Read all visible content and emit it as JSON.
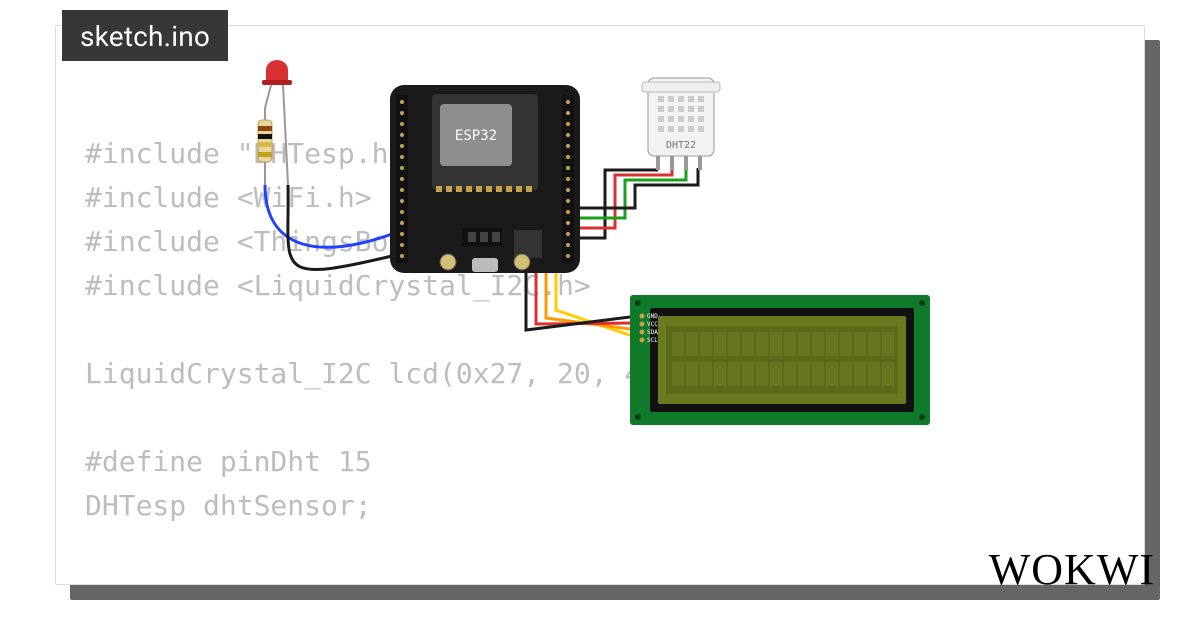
{
  "tab": {
    "filename": "sketch.ino"
  },
  "code": {
    "line1": "#include \"DHTesp.h\"",
    "line2": "#include <WiFi.h>",
    "line3": "#include <ThingsBoard.h>",
    "line4": "#include <LiquidCrystal_I2C.h>",
    "line5": "",
    "line6": "LiquidCrystal_I2C lcd(0x27, 20, 4);",
    "line7": "",
    "line8": "#define pinDht 15",
    "line9": "DHTesp dhtSensor;"
  },
  "components": {
    "mcu": {
      "label": "ESP32"
    },
    "sensor": {
      "label": "DHT22"
    },
    "lcd": {
      "pins": [
        "GND",
        "VCC",
        "SDA",
        "SCL"
      ]
    },
    "led": {
      "color": "#d83131"
    }
  },
  "colors": {
    "board": "#1a1a1a",
    "chip": "#8e8e8e",
    "lcd_pcb": "#0e7a2a",
    "lcd_screen": "#6b7a1e",
    "lcd_glass": "#4a5815",
    "wire_power": "#d83131",
    "wire_gnd": "#1a1a1a",
    "wire_data1": "#ffcc00",
    "wire_data2": "#ff9a00",
    "wire_data3": "#1aa01a",
    "wire_blue": "#2040ff"
  },
  "brand": {
    "name": "WOKWI"
  }
}
